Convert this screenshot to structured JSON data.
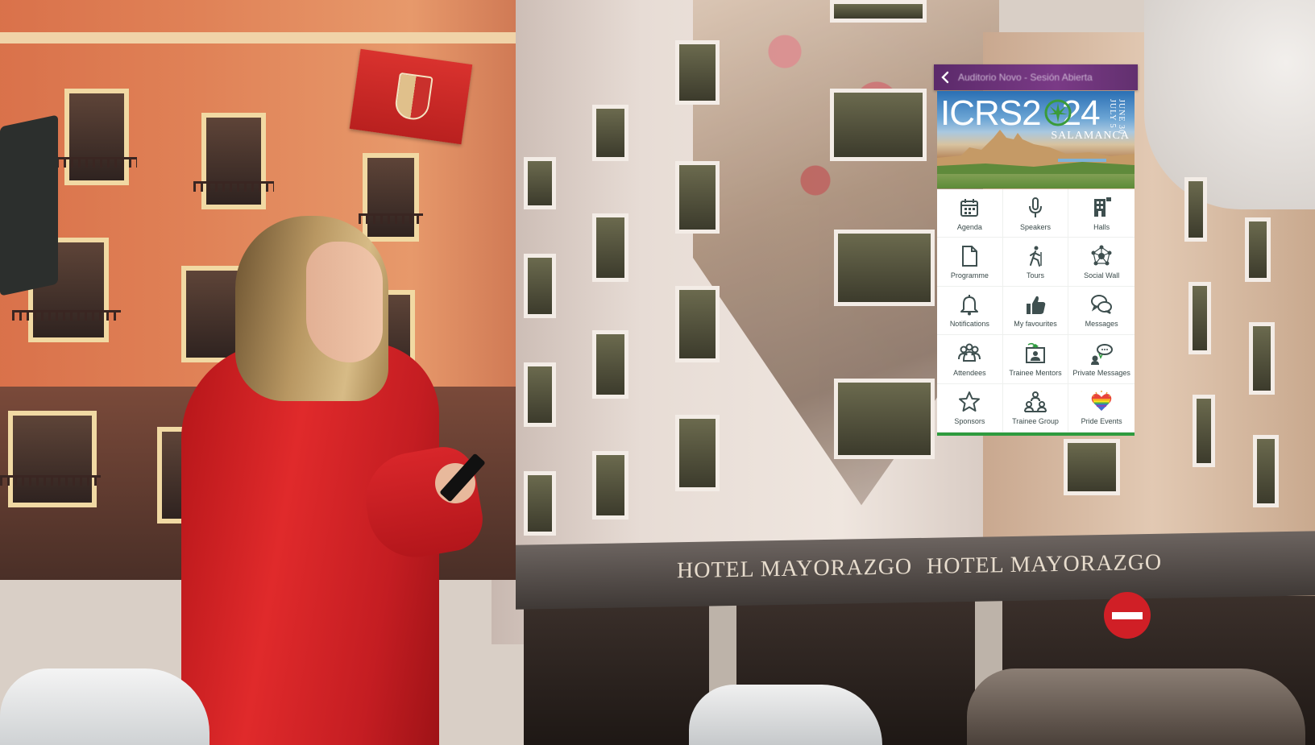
{
  "app": {
    "topbar_title": "Auditorio Novo - Sesión Abierta",
    "banner": {
      "title_left": "ICRS2",
      "title_right": "24",
      "dates": "JUNE 30 · JULY 5",
      "city": "SALAMANCA"
    },
    "menu": [
      {
        "label": "Agenda",
        "icon": "calendar-icon"
      },
      {
        "label": "Speakers",
        "icon": "microphone-icon"
      },
      {
        "label": "Halls",
        "icon": "building-icon"
      },
      {
        "label": "Programme",
        "icon": "document-icon"
      },
      {
        "label": "Tours",
        "icon": "hiker-icon"
      },
      {
        "label": "Social Wall",
        "icon": "network-icon"
      },
      {
        "label": "Notifications",
        "icon": "bell-icon"
      },
      {
        "label": "My favourites",
        "icon": "thumbs-up-icon"
      },
      {
        "label": "Messages",
        "icon": "chat-bubbles-icon"
      },
      {
        "label": "Attendees",
        "icon": "group-icon"
      },
      {
        "label": "Trainee Mentors",
        "icon": "mentor-board-icon"
      },
      {
        "label": "Private Messages",
        "icon": "private-chat-icon"
      },
      {
        "label": "Sponsors",
        "icon": "star-icon"
      },
      {
        "label": "Trainee Group",
        "icon": "team-icon"
      },
      {
        "label": "Pride Events",
        "icon": "rainbow-heart-icon"
      }
    ],
    "colors": {
      "topbar": "#6a3478",
      "icon_dark": "#3e4f4f",
      "accent_green": "#2e9b3e",
      "label": "#3a4a4a"
    }
  },
  "scene": {
    "hotel_sign_left": "HOTEL MAYORAZGO",
    "hotel_sign_right": "HOTEL MAYORAZGO"
  }
}
